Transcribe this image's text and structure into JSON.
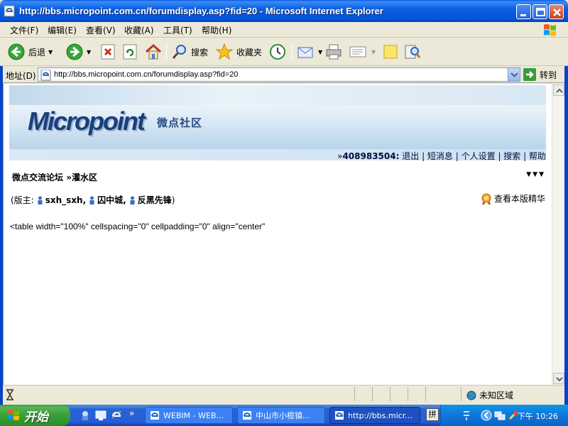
{
  "window": {
    "title": "http://bbs.micropoint.com.cn/forumdisplay.asp?fid=20 - Microsoft Internet Explorer"
  },
  "menu": [
    "文件(F)",
    "编辑(E)",
    "查看(V)",
    "收藏(A)",
    "工具(T)",
    "帮助(H)"
  ],
  "toolbar": {
    "back_label": "后退",
    "search_label": "搜索",
    "favorites_label": "收藏夹"
  },
  "address": {
    "label": "地址(D)",
    "url": "http://bbs.micropoint.com.cn/forumdisplay.asp?fid=20",
    "go_label": "转到"
  },
  "site": {
    "logo_text": "Micropoint",
    "logo_sub": "微点社区"
  },
  "userbar": {
    "prefix": "»",
    "user_id": "408983504:",
    "links": [
      "退出",
      "短消息",
      "个人设置",
      "搜索",
      "帮助"
    ]
  },
  "breadcrumb": {
    "forum": "微点交流论坛",
    "separator": "»",
    "board": "灌水区"
  },
  "moderators": {
    "prefix": "(版主:",
    "names": [
      "sxh_sxh,",
      "囚中城,",
      "反黑先锋"
    ],
    "suffix": ")"
  },
  "digest_label": "查看本版精华",
  "raw_html_text": "<table width=\"100%\" cellspacing=\"0\" cellpadding=\"0\" align=\"center\"",
  "status": {
    "zone_label": "未知区域"
  },
  "taskbar": {
    "start_label": "开始",
    "tasks": [
      "WEBIM - WEB...",
      "中山市小榄镇...",
      "http://bbs.micr..."
    ],
    "clock": "下午 10:26"
  },
  "colors": {
    "title_bar": "#0a5ce6",
    "taskbar": "#245edb",
    "start_button": "#35a135",
    "link_text": "#000d3d"
  }
}
